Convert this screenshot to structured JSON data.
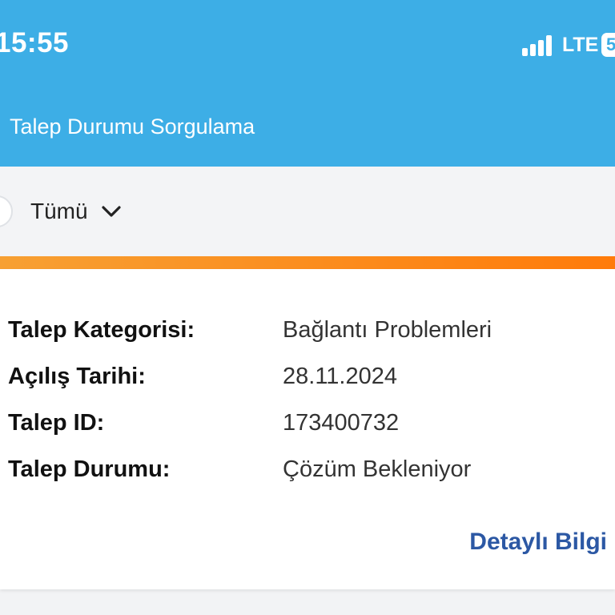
{
  "status_bar": {
    "time": "15:55",
    "network": "LTE",
    "battery": "5"
  },
  "header": {
    "title": "Talep Durumu Sorgulama"
  },
  "filter": {
    "selected": "Tümü"
  },
  "request": {
    "fields": [
      {
        "label": "Talep Kategorisi:",
        "value": "Bağlantı Problemleri"
      },
      {
        "label": "Açılış Tarihi:",
        "value": "28.11.2024"
      },
      {
        "label": "Talep ID:",
        "value": "173400732"
      },
      {
        "label": "Talep Durumu:",
        "value": "Çözüm Bekleniyor"
      }
    ],
    "detail_link": "Detaylı Bilgi"
  },
  "colors": {
    "header_bg": "#3daee6",
    "accent_orange": "#ff7b0a",
    "link_blue": "#2c58a4"
  },
  "icons": {
    "signal": "signal-icon",
    "battery": "battery-icon",
    "chevron": "chevron-down-icon"
  }
}
